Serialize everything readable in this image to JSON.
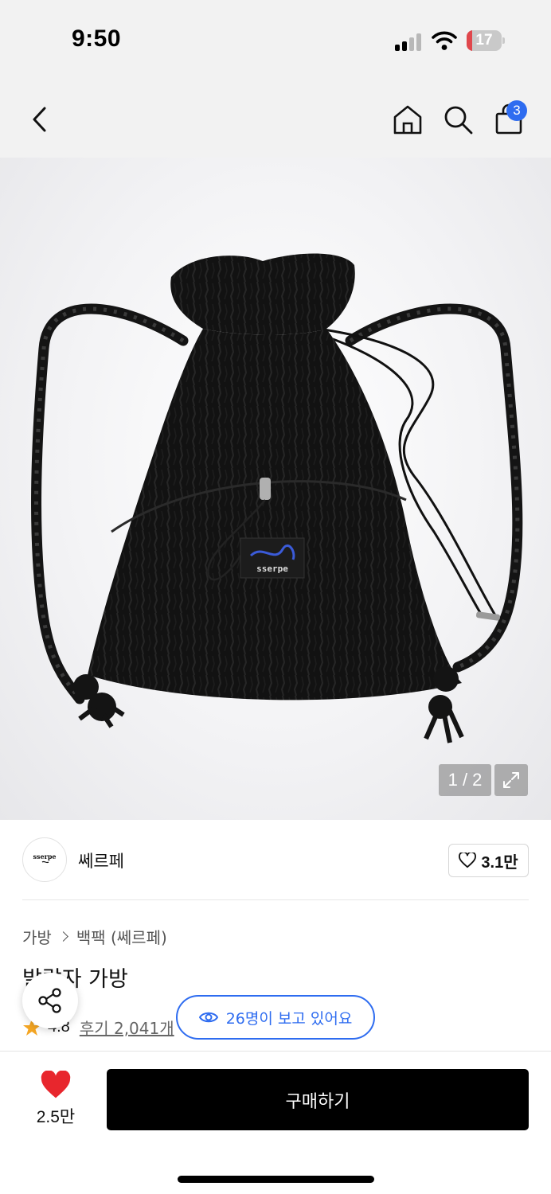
{
  "status_bar": {
    "time": "9:50",
    "battery_level": "17",
    "battery_color": "#e0474c"
  },
  "header": {
    "back_icon": "chevron-left-icon",
    "home_icon": "home-icon",
    "search_icon": "search-icon",
    "cart_icon": "shopping-bag-icon",
    "cart_count": "3",
    "badge_color": "#2e6cf0"
  },
  "product_image": {
    "counter": "1 / 2",
    "expand_icon": "expand-icon"
  },
  "brand": {
    "name": "쎄르페",
    "logo_text": "sserpe",
    "like_count": "3.1만"
  },
  "product": {
    "breadcrumb": [
      "가방",
      "백팩 (쎄르페)"
    ],
    "title": "발랄자 가방",
    "rating": "4.8",
    "reviews": "후기 2,041개",
    "viewers": "26명이 보고 있어요"
  },
  "bottom_bar": {
    "wish_count": "2.5만",
    "buy_label": "구매하기",
    "heart_color": "#e8262d"
  }
}
